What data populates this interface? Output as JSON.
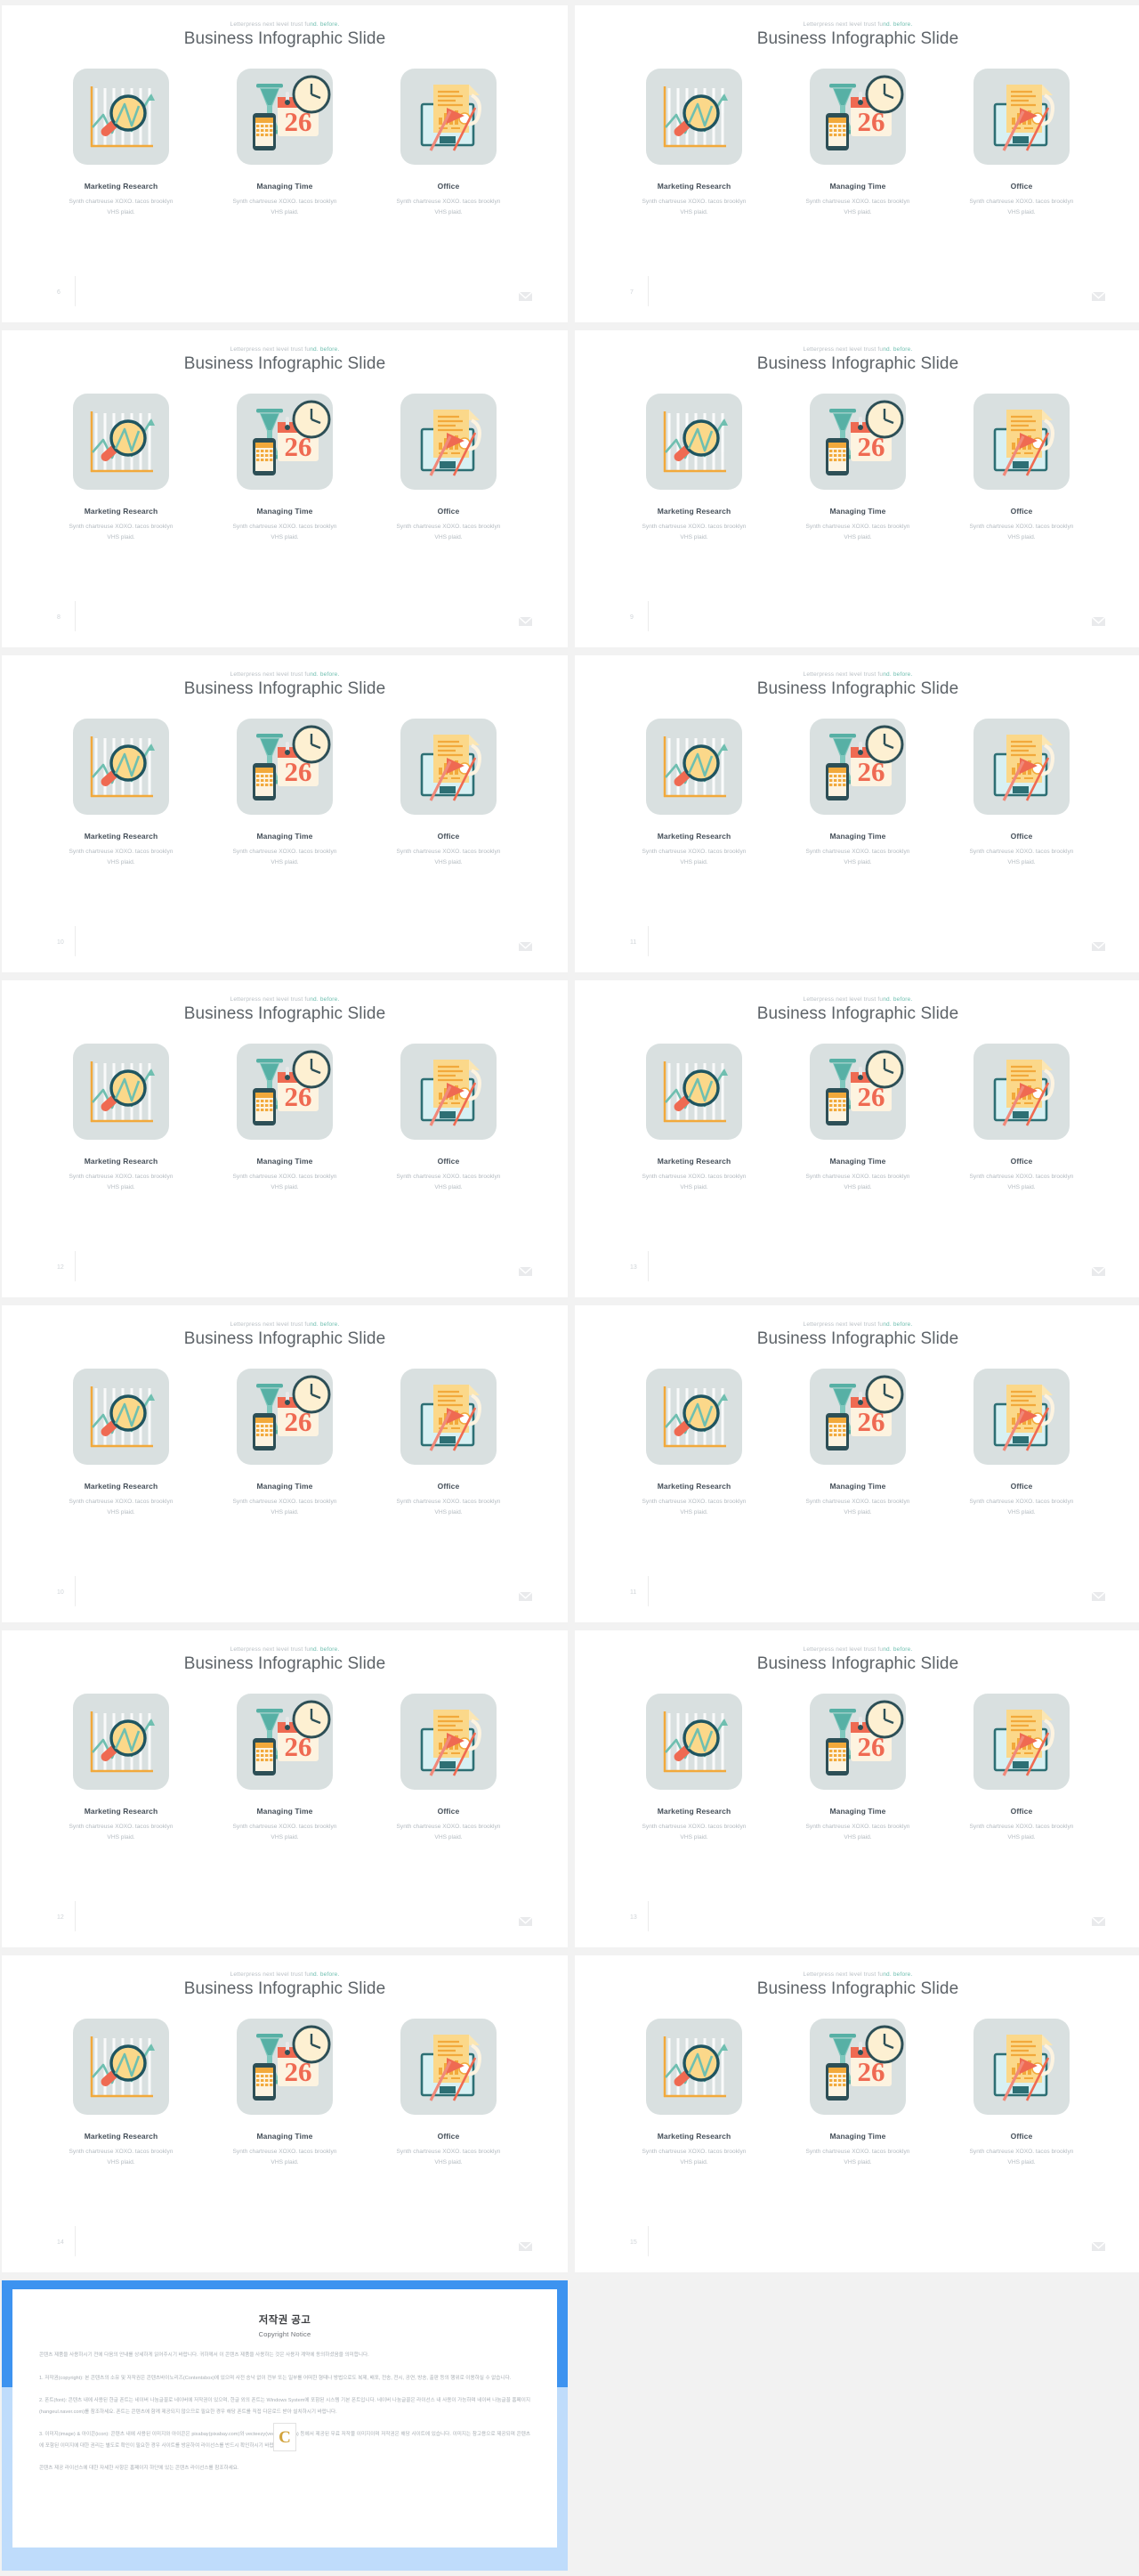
{
  "slide": {
    "eyebrow_pre": "Letterpress next level trust fu",
    "eyebrow_hl": "nd. before.",
    "title": "Business Infographic Slide",
    "mail_icon": "envelope-icon",
    "cards": [
      {
        "icon": "chart-magnifier-icon",
        "title": "Marketing Research",
        "body": "Synth chartreuse XOXO. tacos brooklyn VHS plaid."
      },
      {
        "icon": "hourglass-clock-calendar-icon",
        "title": "Managing Time",
        "body": "Synth chartreuse XOXO. tacos brooklyn VHS plaid."
      },
      {
        "icon": "document-monitor-icon",
        "title": "Office",
        "body": "Synth chartreuse XOXO. tacos brooklyn VHS plaid."
      }
    ]
  },
  "slide_numbers": [
    "6",
    "7",
    "8",
    "9",
    "10",
    "11",
    "12",
    "13",
    "10",
    "11",
    "12",
    "13",
    "14",
    "15"
  ],
  "colors": {
    "thumb_bg": "#d9e0e0",
    "accent_teal": "#6fbfb0",
    "accent_orange": "#f2a93b",
    "accent_red": "#ef6a52",
    "accent_yellow": "#fbd88a",
    "title_gray": "#5d6368",
    "copyright_blue": "#3d93f0",
    "copyright_blue_light": "#bfdcfb",
    "seal_gold": "#d2a33c"
  },
  "copyright": {
    "title_ko": "저작권 공고",
    "title_en": "Copyright Notice",
    "seal_letter": "C",
    "paragraphs": [
      "콘텐츠 제품을 사용하시기 전에 다음의 안내를 상세하게 읽어주시기 바랍니다. 귀하께서 이 콘텐츠 제품을 사용하는 것은 사용자 계약에 동의하셨음을 의미합니다.",
      "1. 저작권(copyright): 본 콘텐츠의 소유 및 저작권은 콘텐츠바이노리즈(Contentsbox)에 있으며 사전 승낙 없이 전부 또는 일부를 어떠한 형태나 방법으로도 복제, 배포, 전송, 전시, 공연, 방송, 출판 등의 행위로 이용하실 수 없습니다.",
      "2. 폰트(font): 콘텐츠 내에 사용된 한글 폰트는 네이버 나눔글꼴로 네이버에 저작권이 있으며, 한글 외의 폰트는 Windows System에 포함된 시스템 기본 폰트입니다. 네이버 나눔글꼴은 라이선스 내 사용이 가능하며 네이버 나눔글꼴 홈페이지(hangeul.naver.com)를 참조하세요. 폰트는 콘텐츠에 함께 제공되지 않으므로 필요한 경우 해당 폰트를 직접 다운로드 받아 설치하시기 바랍니다.",
      "3. 이미지(image) & 아이콘(icon): 콘텐츠 내에 사용된 이미지와 아이콘은 pixabay(pixabay.com)와 vecteezy(vecteezy.com) 등에서 제공된 무료 저작물 이미지이며 저작권은 해당 사이트에 있습니다. 이미지는 참고용으로 제공되며 콘텐츠에 포함된 이미지에 대한 권리는 별도로 확인이 필요한 경우 사이트를 방문하여 라이선스를 반드시 확인하시기 바랍니다.",
      "콘텐츠 제공 라이선스에 대한 자세한 사항은 홈페이지 하단에 있는 콘텐츠 라이선스를 참조하세요."
    ]
  }
}
